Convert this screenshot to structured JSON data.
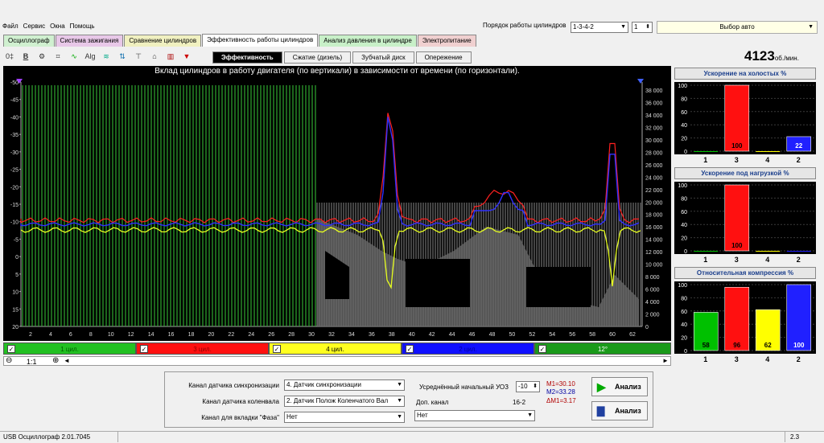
{
  "menu": [
    "Файл",
    "Сервис",
    "Окна",
    "Помощь"
  ],
  "cylinder_order": {
    "label": "Порядок работы цилиндров",
    "value": "1-3-4-2",
    "stepper": "1"
  },
  "car_select": "Выбор авто",
  "tabs_main": [
    {
      "label": "Осциллограф",
      "color": "#d0f0d0"
    },
    {
      "label": "Система зажигания",
      "color": "#e8c8e8"
    },
    {
      "label": "Сравнение цилиндров",
      "color": "#f0f0c0"
    },
    {
      "label": "Эффективность работы цилиндров",
      "color": "#ffffff"
    },
    {
      "label": "Анализ давления в цилиндре",
      "color": "#c8f0c8"
    },
    {
      "label": "Электропитание",
      "color": "#f0d0d0"
    }
  ],
  "subtabs": [
    "Эффективность",
    "Сжатие (дизель)",
    "Зубчатый диск",
    "Опережение"
  ],
  "rpm": {
    "value": "4123",
    "unit": "об./мин."
  },
  "main_chart": {
    "title": "Вклад цилиндров в работу двигателя (по вертикали) в зависимости от времени (по горизонтали).",
    "left_ticks": [
      "-50",
      "-45",
      "-40",
      "-35",
      "-30",
      "-25",
      "-20",
      "-15",
      "-10",
      "-5",
      "0",
      "5",
      "10",
      "15",
      "20"
    ],
    "right_ticks": [
      "38 000",
      "36 000",
      "34 000",
      "32 000",
      "30 000",
      "28 000",
      "26 000",
      "24 000",
      "22 000",
      "20 000",
      "18 000",
      "16 000",
      "14 000",
      "12 000",
      "10 000",
      "8 000",
      "6 000",
      "4 000",
      "2 000",
      "0"
    ],
    "x_ticks": [
      "2",
      "4",
      "6",
      "8",
      "10",
      "12",
      "14",
      "16",
      "18",
      "20",
      "22",
      "24",
      "26",
      "28",
      "30",
      "32",
      "34",
      "36",
      "38",
      "40",
      "42",
      "44",
      "46",
      "48",
      "50",
      "52",
      "54",
      "56",
      "58",
      "60",
      "62"
    ]
  },
  "cylinders": [
    {
      "label": "1 цил.",
      "color": "#22c022",
      "text_color": "#006000",
      "checked": "✓"
    },
    {
      "label": "3 цил.",
      "color": "#ff1010",
      "text_color": "#900000",
      "checked": "✓"
    },
    {
      "label": "4 цил.",
      "color": "#ffff20",
      "text_color": "#000000",
      "checked": "✓"
    },
    {
      "label": "2 цил.",
      "color": "#1010ff",
      "text_color": "#0000a0",
      "checked": "✓"
    },
    {
      "label": "12°",
      "color": "#1a9a1a",
      "text_color": "#ffffff",
      "checked": "✓"
    }
  ],
  "zoom_row": {
    "minus": "⊖",
    "ratio": "1:1",
    "plus": "⊕"
  },
  "right_charts": [
    {
      "title": "Ускорение на холостых %",
      "ticks": [
        "100",
        "80",
        "60",
        "40",
        "20",
        "0"
      ],
      "labels": [
        "1",
        "3",
        "4",
        "2"
      ],
      "values": [
        0,
        100,
        0,
        22
      ],
      "value_labels": [
        "",
        "100",
        "",
        "22"
      ],
      "colors": [
        "#00c000",
        "#ff1010",
        "#ffff00",
        "#2020ff"
      ]
    },
    {
      "title": "Ускорение под нагрузкой %",
      "ticks": [
        "100",
        "80",
        "60",
        "40",
        "20",
        "0"
      ],
      "labels": [
        "1",
        "3",
        "4",
        "2"
      ],
      "values": [
        0,
        100,
        0,
        0
      ],
      "value_labels": [
        "",
        "100",
        "",
        ""
      ],
      "colors": [
        "#00c000",
        "#ff1010",
        "#ffff00",
        "#2020ff"
      ]
    },
    {
      "title": "Относительная компрессия %",
      "ticks": [
        "100",
        "80",
        "60",
        "40",
        "20",
        "0"
      ],
      "labels": [
        "1",
        "3",
        "4",
        "2"
      ],
      "values": [
        58,
        96,
        62,
        100
      ],
      "value_labels": [
        "58",
        "96",
        "62",
        "100"
      ],
      "colors": [
        "#00c000",
        "#ff1010",
        "#ffff00",
        "#2020ff"
      ]
    }
  ],
  "bottom": {
    "sync_label": "Канал датчика синхронизации",
    "sync_value": "4. Датчик синхронизации",
    "crank_label": "Канал датчика коленвала",
    "crank_value": "2. Датчик Полож Коленчатого Вал",
    "phase_label": "Канал для вкладки \"Фаза\"",
    "phase_value": "Нет",
    "uoz_label": "Усреднённый начальный УОЗ",
    "uoz_value": "-10",
    "dop_label": "Доп. канал",
    "dop_code": "16-2",
    "dop_value": "Нет",
    "m1": "M1=30.10",
    "m2": "M2=33.28",
    "dm": "ΔM1=3.17",
    "btn1": "Анализ",
    "btn2": "Анализ"
  },
  "status": {
    "app": "USB Осциллограф  2.01.7045",
    "right": "2.3"
  }
}
